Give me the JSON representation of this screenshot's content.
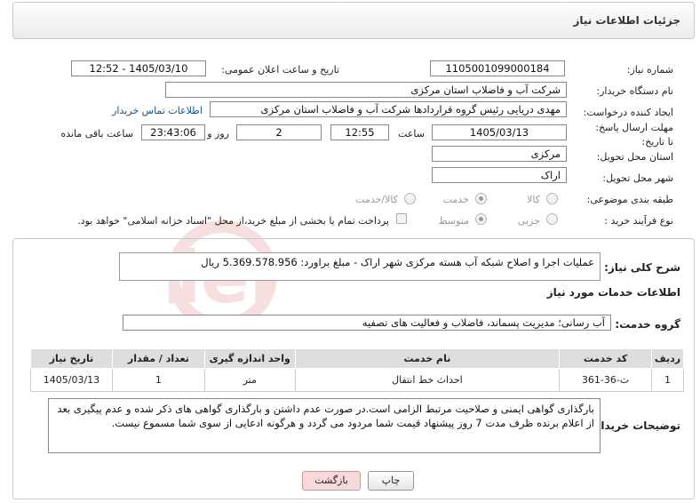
{
  "header": {
    "title": "جزئیات اطلاعات نیاز"
  },
  "need_number": {
    "label": "شماره نیاز:",
    "value": "1105001099000184"
  },
  "announce_datetime": {
    "label": "تاریخ و ساعت اعلان عمومی:",
    "value": "1405/03/10 - 12:52"
  },
  "buyer_org": {
    "label": "نام دستگاه خریدار:",
    "value": "شرکت آب و فاضلاب استان مرکزی"
  },
  "requester": {
    "label": "ایجاد کننده درخواست:",
    "value": "مهدی دریایی رئیس گروه قراردادها شرکت آب و فاضلاب استان مرکزی",
    "contact_link": "اطلاعات تماس خریدار"
  },
  "deadline": {
    "label": "مهلت ارسال پاسخ: تا تاریخ:",
    "date": "1405/03/13",
    "time_label": "ساعت",
    "time": "12:55",
    "days": "2",
    "days_label": "روز و",
    "remaining": "23:43:06",
    "remaining_label": "ساعت باقی مانده"
  },
  "province": {
    "label": "استان محل تحویل:",
    "value": "مرکزی"
  },
  "city": {
    "label": "شهر محل تحویل:",
    "value": "اراک"
  },
  "category": {
    "label": "طبقه بندی موضوعی:",
    "options": [
      "کالا",
      "خدمت",
      "کالا/خدمت"
    ],
    "selected": "خدمت"
  },
  "process": {
    "label": "نوع فرآیند خرید :",
    "options": [
      "جزیی",
      "متوسط"
    ],
    "selected": "متوسط",
    "note": "پرداخت تمام یا بخشی از مبلغ خرید،از محل \"اسناد خزانه اسلامی\" خواهد بود."
  },
  "general_desc": {
    "label": "شرح کلی نیاز:",
    "value": "عملیات اجرا و اصلاح شبکه آب هسته مرکزی شهر اراک - مبلغ براورد: 5.369.578.956 ریال"
  },
  "services_section": {
    "title": "اطلاعات خدمات مورد نیاز"
  },
  "service_group": {
    "label": "گروه خدمت:",
    "value": "آب رسانی؛ مدیریت پسماند، فاضلاب و فعالیت های تصفیه"
  },
  "table": {
    "headers": [
      "ردیف",
      "کد خدمت",
      "نام خدمت",
      "واحد اندازه گیری",
      "تعداد / مقدار",
      "تاریخ نیاز"
    ],
    "rows": [
      [
        "1",
        "ث-36-361",
        "احداث خط انتقال",
        "متر",
        "1",
        "1405/03/13"
      ]
    ]
  },
  "buyer_notes": {
    "label": "توضیحات خریدار:",
    "value": "بارگذاری گواهی ایمنی و صلاحیت مرتبط الزامی است.در صورت عدم داشتن و بارگذاری گواهی های ذکر شده و عدم پیگیری بعد از اعلام برنده ظرف مدت 7 روز پیشنهاد قیمت شما مردود می گردد و هرگونه ادعایی از سوی شما مسموع نیست."
  },
  "buttons": {
    "print": "چاپ",
    "back": "بازگشت"
  },
  "colors": {
    "link": "#0a58a6",
    "back_button_bg": "#f7d9d9",
    "header_border": "#c9c9c9"
  }
}
